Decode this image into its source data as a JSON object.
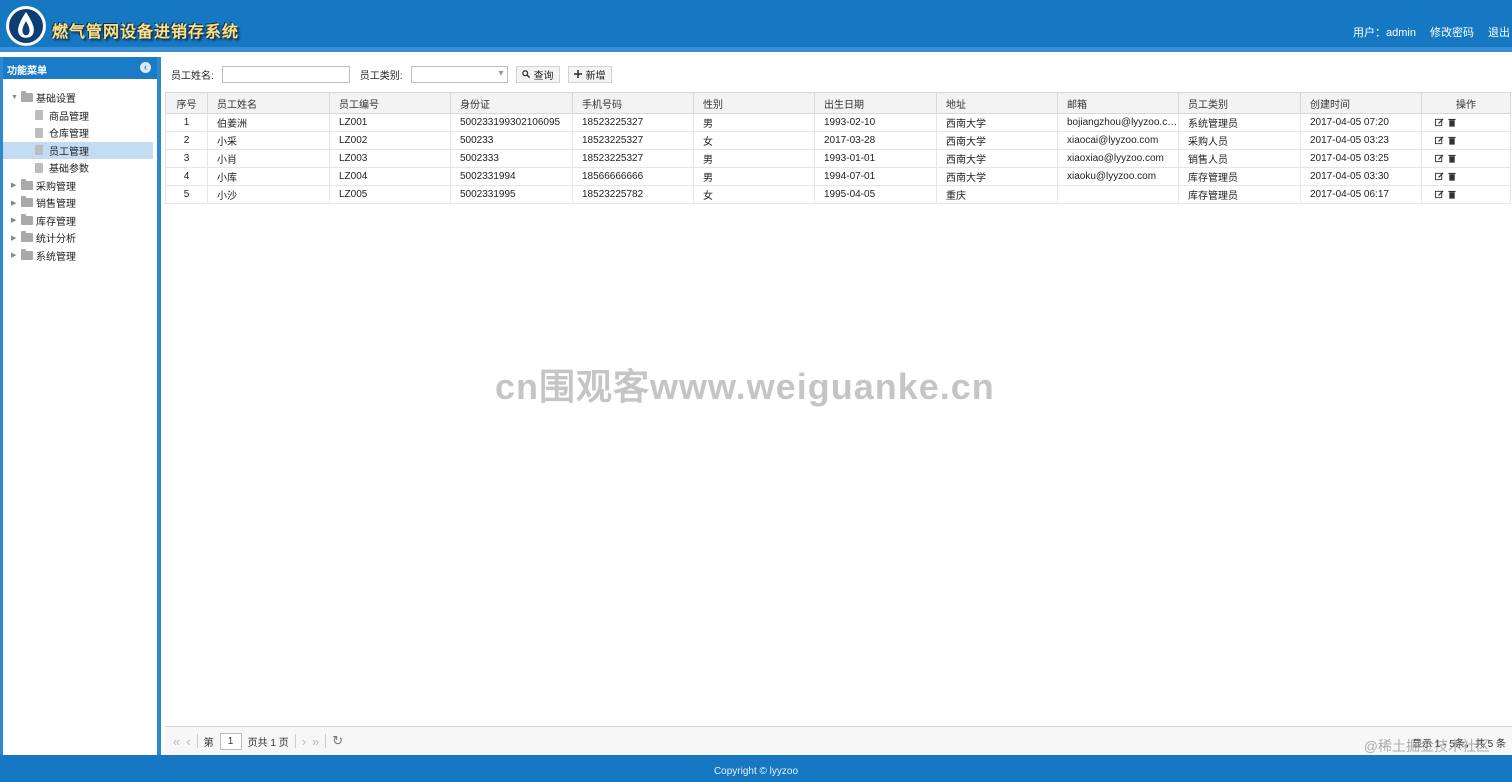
{
  "header": {
    "title": "燃气管网设备进销存系统",
    "user_label": "用户：admin",
    "change_password": "修改密码",
    "logout": "退出"
  },
  "sidebar": {
    "title": "功能菜单",
    "groups": [
      {
        "label": "基础设置",
        "expanded": true,
        "children": [
          "商品管理",
          "仓库管理",
          "员工管理",
          "基础参数"
        ]
      },
      {
        "label": "采购管理"
      },
      {
        "label": "销售管理"
      },
      {
        "label": "库存管理"
      },
      {
        "label": "统计分析"
      },
      {
        "label": "系统管理"
      }
    ],
    "selected": "员工管理"
  },
  "toolbar": {
    "name_label": "员工姓名:",
    "name_value": "",
    "type_label": "员工类别:",
    "type_value": "",
    "search_btn": "查询",
    "add_btn": "新增"
  },
  "table": {
    "columns": [
      "序号",
      "员工姓名",
      "员工编号",
      "身份证",
      "手机号码",
      "性别",
      "出生日期",
      "地址",
      "邮箱",
      "员工类别",
      "创建时间",
      "操作"
    ],
    "rows": [
      [
        "1",
        "伯姜洲",
        "LZ001",
        "500233199302106095",
        "18523225327",
        "男",
        "1993-02-10",
        "西南大学",
        "bojiangzhou@lyyzoo.com",
        "系统管理员",
        "2017-04-05 07:20"
      ],
      [
        "2",
        "小采",
        "LZ002",
        "500233",
        "18523225327",
        "女",
        "2017-03-28",
        "西南大学",
        "xiaocai@lyyzoo.com",
        "采购人员",
        "2017-04-05 03:23"
      ],
      [
        "3",
        "小肖",
        "LZ003",
        "5002333",
        "18523225327",
        "男",
        "1993-01-01",
        "西南大学",
        "xiaoxiao@lyyzoo.com",
        "销售人员",
        "2017-04-05 03:25"
      ],
      [
        "4",
        "小库",
        "LZ004",
        "5002331994",
        "18566666666",
        "男",
        "1994-07-01",
        "西南大学",
        "xiaoku@lyyzoo.com",
        "库存管理员",
        "2017-04-05 03:30"
      ],
      [
        "5",
        "小沙",
        "LZ005",
        "5002331995",
        "18523225782",
        "女",
        "1995-04-05",
        "重庆",
        "",
        "库存管理员",
        "2017-04-05 06:17"
      ]
    ]
  },
  "pager": {
    "page_prefix": "第",
    "page_value": "1",
    "page_suffix": "页共 1 页",
    "info": "显示 1 - 5条，共 5 条"
  },
  "footer": {
    "copyright": "Copyright © lyyzoo"
  },
  "watermarks": {
    "center": "cn围观客www.weiguanke.cn",
    "corner": "@稀土掘金技术社区"
  },
  "colors": {
    "brand": "#1678c2",
    "selected": "#c3dcf4",
    "title": "#ffe27a"
  }
}
